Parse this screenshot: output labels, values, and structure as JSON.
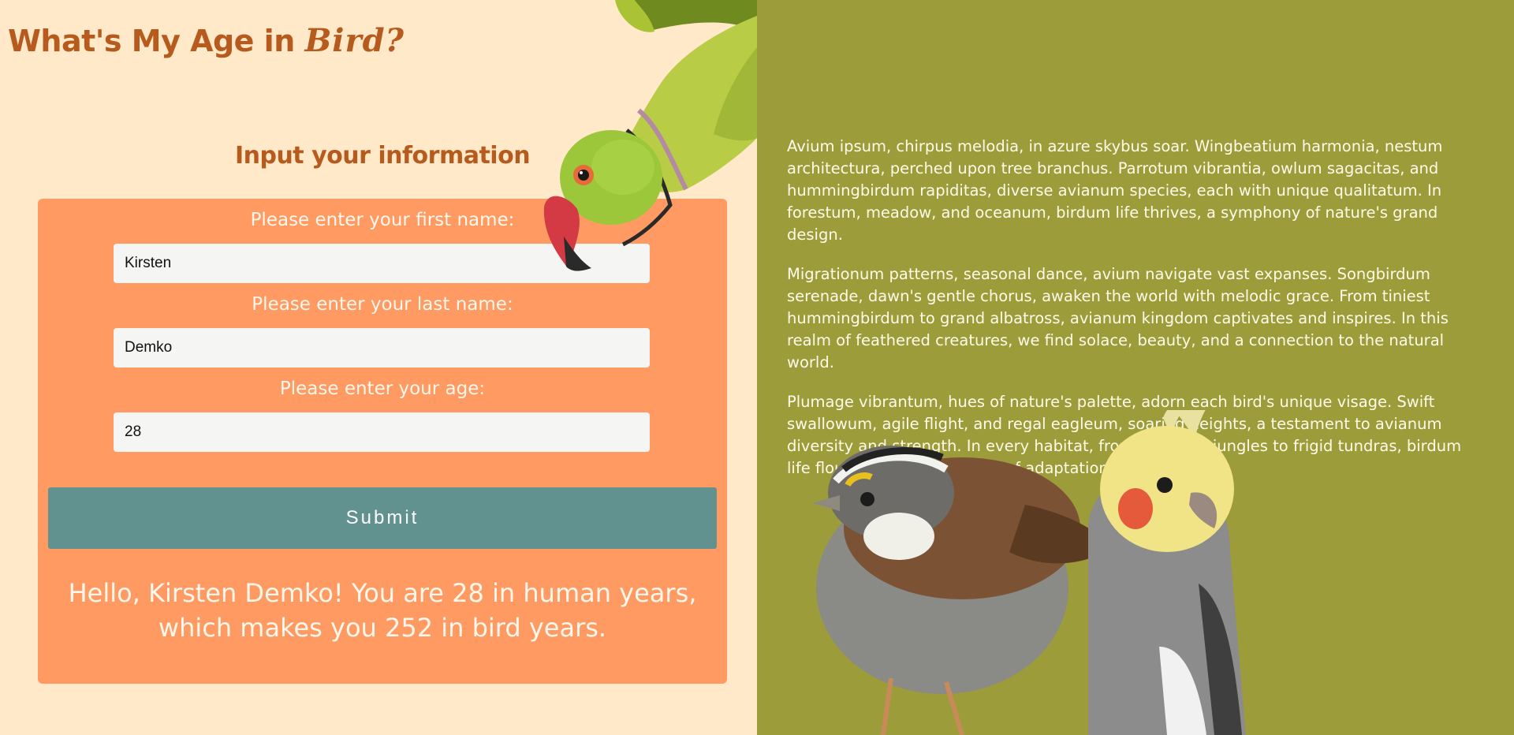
{
  "header": {
    "title_prefix": "What's My Age in",
    "title_highlight": "Bird?"
  },
  "form": {
    "heading": "Input your information",
    "first_name_label": "Please enter your first name:",
    "first_name_value": "Kirsten",
    "last_name_label": "Please enter your last name:",
    "last_name_value": "Demko",
    "age_label": "Please enter your age:",
    "age_value": "28",
    "submit_label": "Submit",
    "result": "Hello, Kirsten Demko! You are 28 in human years, which makes you 252 in bird years."
  },
  "info": {
    "paragraphs": [
      "Avium ipsum, chirpus melodia, in azure skybus soar. Wingbeatium harmonia, nestum architectura, perched upon tree branchus. Parrotum vibrantia, owlum sagacitas, and hummingbirdum rapiditas, diverse avianum species, each with unique qualitatum. In forestum, meadow, and oceanum, birdum life thrives, a symphony of nature's grand design.",
      "Migrationum patterns, seasonal dance, avium navigate vast expanses. Songbirdum serenade, dawn's gentle chorus, awaken the world with melodic grace. From tiniest hummingbirdum to grand albatross, avianum kingdom captivates and inspires. In this realm of feathered creatures, we find solace, beauty, and a connection to the natural world.",
      "Plumage vibrantum, hues of nature's palette, adorn each bird's unique visage. Swift swallowum, agile flight, and regal eagleum, soaring heights, a testament to avianum diversity and strength. In every habitat, from tropicum jungles to frigid tundras, birdum life flourishes, a celebration of adaptation and resilience."
    ]
  },
  "images": {
    "top_bird": "parakeet-icon",
    "bottom_birds": [
      "sparrow-icon",
      "cockatiel-icon"
    ]
  },
  "colors": {
    "left_background": "#ffe9c9",
    "right_background": "#9c9c3b",
    "card": "#ff9b62",
    "accent_text": "#b65a1d",
    "submit_button": "#619290"
  }
}
